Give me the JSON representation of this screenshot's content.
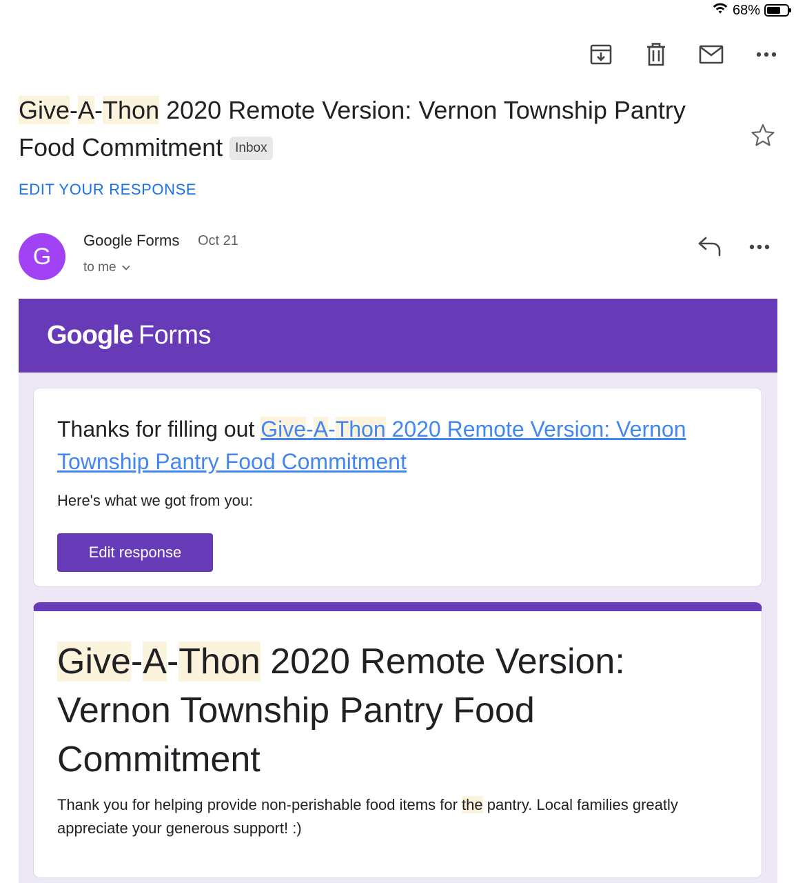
{
  "status": {
    "battery_label": "68%",
    "battery_level": 0.68
  },
  "subject": {
    "parts": [
      "Give",
      "-",
      "A",
      "-",
      "Thon",
      " 2020 Remote Version: Vernon Township Pantry Food Commitment"
    ],
    "badge": "Inbox"
  },
  "edit_link": "EDIT YOUR RESPONSE",
  "sender": {
    "initial": "G",
    "name": "Google Forms",
    "date": "Oct 21",
    "to": "to me"
  },
  "header": {
    "logo_google": "Google",
    "logo_forms": "Forms"
  },
  "card1": {
    "thanks_prefix": "Thanks for filling out ",
    "form_link": {
      "parts": [
        "Give",
        "-",
        "A",
        "-",
        "Thon",
        " 2020 Remote Version: Vernon Township Pantry Food Commitment"
      ]
    },
    "got_text": "Here's what we got from you:",
    "edit_button": "Edit response"
  },
  "card2": {
    "title_parts": [
      "Give",
      "-",
      "A",
      "-",
      "Thon",
      " 2020 Remote Version: Vernon Township Pantry Food Commitment"
    ],
    "desc_parts": [
      "Thank you for helping provide non-perishable food items for ",
      "the",
      " pantry. Local families greatly appreciate your generous support! :)"
    ]
  },
  "colors": {
    "brand": "#673ab7",
    "link": "#1a73e8",
    "avatar": "#a142f4",
    "highlight": "#fcf3dc",
    "body_bg": "#ede7f6"
  }
}
